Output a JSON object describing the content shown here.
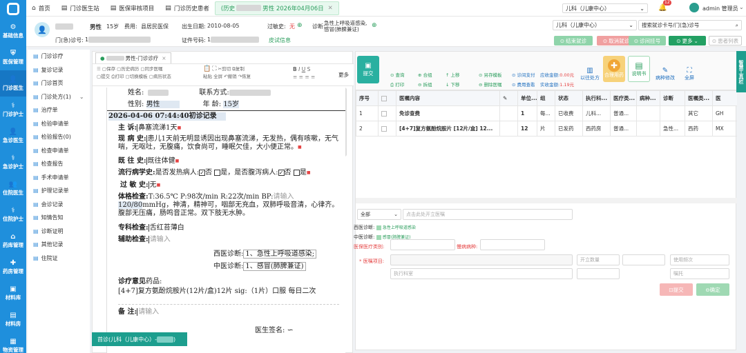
{
  "nav": {
    "items": [
      {
        "label": "基础信息",
        "icon": "gear-icon",
        "glyph": "⚙"
      },
      {
        "label": "医保管理",
        "icon": "shield-icon",
        "glyph": "⛨"
      },
      {
        "label": "门诊医生",
        "icon": "doctor-icon",
        "glyph": "👤",
        "active": true
      },
      {
        "label": "门诊护士",
        "icon": "nurse-icon",
        "glyph": "⚕"
      },
      {
        "label": "急诊医生",
        "icon": "doctor-icon",
        "glyph": "👤"
      },
      {
        "label": "急诊护士",
        "icon": "nurse-icon",
        "glyph": "⚕"
      },
      {
        "label": "住院医生",
        "icon": "doctor-icon",
        "glyph": "👥"
      },
      {
        "label": "住院护士",
        "icon": "nurse-icon",
        "glyph": "⚕"
      },
      {
        "label": "药库管理",
        "icon": "warehouse-icon",
        "glyph": "⌂"
      },
      {
        "label": "药房管理",
        "icon": "pill-icon",
        "glyph": "✚"
      },
      {
        "label": "材料库",
        "icon": "box-icon",
        "glyph": "▣"
      },
      {
        "label": "材料房",
        "icon": "box-icon",
        "glyph": "▤"
      },
      {
        "label": "物资管理",
        "icon": "package-icon",
        "glyph": "▦"
      }
    ]
  },
  "topbar": {
    "tabs": [
      {
        "label": "首页",
        "icon": "home-icon",
        "glyph": "⌂"
      },
      {
        "label": "门诊医生站",
        "icon": "document-icon",
        "glyph": "▤"
      },
      {
        "label": "医保审核项目",
        "icon": "document-icon",
        "glyph": "▤"
      },
      {
        "label": "门诊历史患者",
        "icon": "document-icon",
        "glyph": "▤"
      },
      {
        "label": "(历史",
        "suffix": "男性 2026年04月06日",
        "active": true
      }
    ],
    "dept": "儿科（儿康中心）",
    "notif_count": "12",
    "user": "admin 管理员"
  },
  "patient": {
    "sex": "男性",
    "age": "15岁",
    "fee_label": "费用:",
    "fee": "县居民医保",
    "birth_label": "出生日期:",
    "birth": "2010-08-05",
    "allergy_label": "过敏史:",
    "allergy": "无",
    "diag_label": "诊断:",
    "diag": "急性上呼吸道感染,",
    "diag2": "感冒(肺脾兼证)",
    "visit_label": "门(急)诊号:",
    "visit_prefix": "1",
    "id_label": "证件号码:",
    "id_prefix": "1",
    "skin_test": "皮试信息",
    "dept_select": "儿科（儿康中心）",
    "search_placeholder": "搜索就诊卡号/门(急)诊号",
    "buttons": [
      {
        "label": "结束就诊",
        "icon": "check-circle-icon",
        "color": "#8fd4aa"
      },
      {
        "label": "取消就诊",
        "icon": "cancel-icon",
        "color": "#f0a0a0"
      },
      {
        "label": "诊间挂号",
        "icon": "register-icon",
        "color": "#8fd4aa"
      },
      {
        "label": "更多",
        "icon": "more-icon",
        "color": "#23a063"
      },
      {
        "label": "患者列表",
        "icon": "list-icon",
        "color": "#ffffff"
      }
    ]
  },
  "side2": {
    "items": [
      "门诊诊疗",
      "复诊记录",
      "门诊首页",
      "门诊处方(1)",
      "治疗单",
      "检验申请单",
      "检验报告(0)",
      "检查申请单",
      "检查报告",
      "手术申请单",
      "护理记录单",
      "会诊记录",
      "知情告知",
      "诊断证明",
      "其他记录",
      "住院证"
    ]
  },
  "editor": {
    "tab_label": "男性-门诊诊疗",
    "toolbar": [
      "保存",
      "历史病历",
      "同步医嘱",
      "提交",
      "打印",
      "切换模板",
      "病历状态",
      "粘贴",
      "全屏",
      "剪切",
      "撤销",
      "复制",
      "恢复",
      "B",
      "I",
      "U",
      "更多"
    ],
    "name_label": "姓名:",
    "contact_label": "联系方式:",
    "sex_label": "性别:",
    "sex_value": "男性",
    "age_label": "年  龄:",
    "age_value": "15岁",
    "header": "2026-04-06 07:44:40初诊记录",
    "chief_label": "主    诉:",
    "chief": "鼻塞流涕1天",
    "hpi_label": "现 病 史:",
    "hpi": "患儿1天前无明显诱因出现鼻塞流涕，无发热，偶有咳嗽，无气喘，无呕吐，无腹痛，饮食尚可，睡眠欠佳，大小便正常。",
    "past_label": "既 往 史:",
    "past": "既往体健",
    "epi_label": "流行病学史:",
    "epi_q1": "是否发热病人:",
    "epi_q2": "是否腹泻病人:",
    "no": "否",
    "yes": "是",
    "allergy_label": "过 敏 史:",
    "allergy": "无",
    "exam_label": "体格检查:",
    "exam_a": "T:36.5℃ P:98次/min R:22次/min BP:",
    "exam_ph": "请输入",
    "exam_b": "120/80",
    "exam_unit": "mmHg",
    "exam_c": "，神清，精神可，咽部无充血，双肺呼吸音清，心律齐。腹部无压痛，肠鸣音正常。双下肢无水肿。",
    "special_label": "专科检查:",
    "special": "舌红苔薄白",
    "aux_label": "辅助检查:",
    "aux_ph": "请输入",
    "wdiag_label": "西医诊断:",
    "wdiag": "1、急性上呼吸道感染;",
    "cdiag_label": "中医诊断:",
    "cdiag": "1、感冒(肺脾兼证)",
    "advice_label": "诊疗意见",
    "advice_sub": "药品:",
    "advice": "[4+7]复方氨酚烷胺片(12片/盒)12片   sig:（1片）口服 每日二次",
    "remark_label": "备    注:",
    "remark_ph": "请输入",
    "sign_label": "医生签名:",
    "footer": "首诊(儿科（儿康中心）-"
  },
  "orders": {
    "toolbar": [
      {
        "label": "查询",
        "icon": "search-icon",
        "glyph": "⊙"
      },
      {
        "label": "打印",
        "icon": "print-icon",
        "glyph": "⎙"
      },
      {
        "label": "合组",
        "icon": "group-icon",
        "glyph": "⊕"
      },
      {
        "label": "拆组",
        "icon": "ungroup-icon",
        "glyph": "⊖"
      },
      {
        "label": "上移",
        "icon": "arrow-up-icon",
        "glyph": "↑"
      },
      {
        "label": "下移",
        "icon": "arrow-down-icon",
        "glyph": "↓"
      },
      {
        "label": "另存模板",
        "icon": "save-icon",
        "glyph": "⊙"
      },
      {
        "label": "删除医嘱",
        "icon": "delete-icon",
        "glyph": "⊖"
      },
      {
        "label": "诊间支付",
        "icon": "pay-icon",
        "glyph": "⊙"
      },
      {
        "label": "费用查看",
        "icon": "fee-icon",
        "glyph": "⊙"
      }
    ],
    "submit": "提交",
    "due_label": "应收金额:",
    "due": "0.00元",
    "paid_label": "实收金额:",
    "paid": "1.19元",
    "history_rx": "以往处方",
    "rational": "合理用药",
    "manual": "说明书",
    "case_edit": "病种修改",
    "fullscreen": "全屏",
    "columns": [
      "序号",
      "",
      "医嘱内容",
      "",
      "单位...",
      "组",
      "状态",
      "执行科...",
      "医疗类...",
      "病种...",
      "诊断",
      "医嘱类...",
      "医"
    ],
    "rows": [
      [
        "1",
        "免诊查费",
        "1",
        "每...",
        "",
        "已收费",
        "儿科...",
        "普通...",
        "",
        "",
        "其它",
        "GH"
      ],
      [
        "2",
        "[4+7]复方氨酚烷胺片 [12片/盒] 12...",
        "12",
        "片",
        "",
        "已发药",
        "西药房",
        "普通...",
        "",
        "急性...",
        "西药",
        "MX"
      ]
    ],
    "filter_value": "全部",
    "filter_ph": "点击此处开立医嘱",
    "wdiag_label": "西医诊断:",
    "wdiag": "急性上呼吸道感染",
    "cdiag_label": "中医诊断:",
    "cdiag": "感冒(肺脾兼证)",
    "ins_type_label": "医保医疗类别:",
    "chronic_label": "慢病病种:",
    "item_label": "医嘱项目:",
    "qty_ph": "开立数量",
    "freq_ph": "使用频次",
    "exec_dept_ph": "执行科室",
    "note_ph": "嘱托",
    "btn_submit": "提交",
    "btn_confirm": "确定"
  },
  "right_strip": "智慧工具栏"
}
